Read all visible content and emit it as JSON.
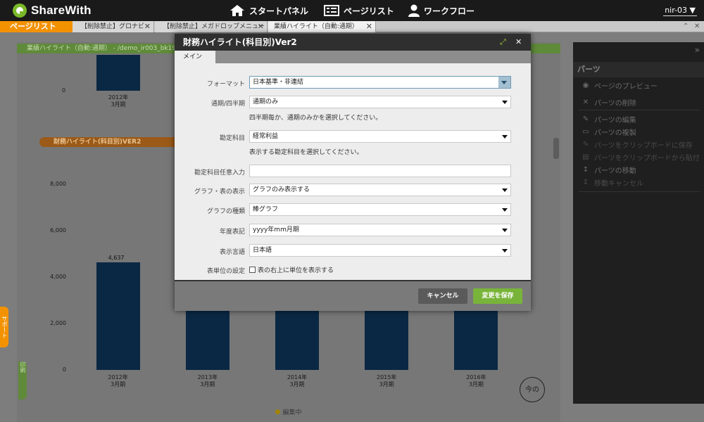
{
  "header": {
    "logo_text": "ShareWith",
    "nav": [
      {
        "label": "スタートパネル",
        "icon": "home-icon"
      },
      {
        "label": "ページリスト",
        "icon": "page-list-icon"
      },
      {
        "label": "ワークフロー",
        "icon": "user-icon"
      }
    ],
    "user": "nir-03"
  },
  "tabs": {
    "list_button": "ページリスト",
    "items": [
      {
        "label": "【削除禁止】グロナビ"
      },
      {
        "label": "【削除禁止】メガドロップメニュー"
      },
      {
        "label": "業績ハイライト（自動:通期）",
        "active": true
      }
    ]
  },
  "background": {
    "strip_text": "業績ハイライト（自動:通期） - /demo_ir003_bk190...",
    "pill_text": "財務ハイライト(科目別)VER2",
    "top_chart": {
      "zero_label": "0",
      "category": "2012年\n3月期"
    },
    "status": "編集中",
    "side_tab_orange": "サポート",
    "side_tab_green": "印刷",
    "round_button": "今の"
  },
  "chart_data": {
    "type": "bar",
    "categories": [
      "2012年\n3月期",
      "2013年\n3月期",
      "2014年\n3月期",
      "2015年\n3月期",
      "2016年\n3月期"
    ],
    "values": [
      4637,
      null,
      null,
      null,
      null
    ],
    "data_labels": [
      "4,637"
    ],
    "yticks": [
      "8,000",
      "6,000",
      "4,000",
      "2,000",
      "0"
    ],
    "ylim": [
      0,
      8000
    ],
    "title": "",
    "xlabel": "",
    "ylabel": ""
  },
  "right_panel": {
    "title": "パーツ",
    "items": [
      {
        "label": "ページのプレビュー",
        "icon": "eye-icon"
      },
      {
        "label": "パーツの削除",
        "icon": "close-icon"
      },
      {
        "label": "パーツの編集",
        "icon": "pencil-icon"
      },
      {
        "label": "パーツの複製",
        "icon": "book-icon"
      },
      {
        "label": "パーツをクリップボードに保存",
        "icon": "pencil-icon"
      },
      {
        "label": "パーツをクリップボードから貼付",
        "icon": "paste-icon"
      },
      {
        "label": "パーツの移動",
        "icon": "move-icon"
      },
      {
        "label": "移動キャンセル",
        "icon": "move-icon"
      }
    ]
  },
  "modal": {
    "title": "財務ハイライト(科目別)Ver2",
    "tab": "メイン",
    "fields": [
      {
        "label": "フォーマット",
        "value": "日本基準・非連結"
      },
      {
        "label": "通期/四半期",
        "value": "通期のみ",
        "help": "四半期毎か、通期のみかを選択してください。"
      },
      {
        "label": "勘定科目",
        "value": "経常利益",
        "help": "表示する勘定科目を選択してください。"
      },
      {
        "label": "勘定科目任意入力",
        "value": ""
      },
      {
        "label": "グラフ・表の表示",
        "value": "グラフのみ表示する"
      },
      {
        "label": "グラフの種類",
        "value": "棒グラフ"
      },
      {
        "label": "年度表記",
        "value": "yyyy年mm月期"
      },
      {
        "label": "表示言語",
        "value": "日本語"
      },
      {
        "label": "表単位の設定",
        "checkbox_label": "表の右上に単位を表示する"
      }
    ],
    "cancel_label": "キャンセル",
    "save_label": "変更を保存"
  }
}
